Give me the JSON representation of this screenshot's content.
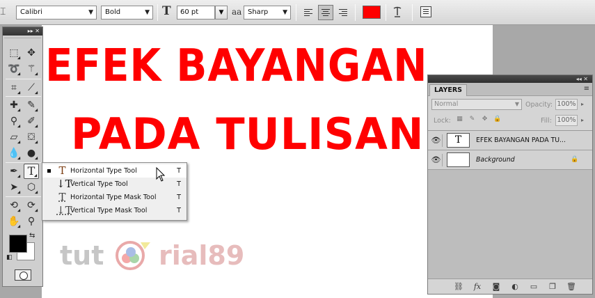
{
  "options_bar": {
    "tool_preset_icon": "type-tool-preset-icon",
    "font_family": "Calibri",
    "font_style": "Bold",
    "font_size": "60 pt",
    "antialias_glyph": "aa",
    "antialias": "Sharp",
    "alignment": [
      "left",
      "center",
      "right"
    ],
    "alignment_selected": "center",
    "text_color": "#ff0000",
    "warp_icon": "warp-text-icon",
    "panels_icon": "character-paragraph-panels-icon"
  },
  "canvas": {
    "line1": "EFEK BAYANGAN",
    "line2": "PADA TULISAN",
    "text_color": "#ff0000",
    "watermark": {
      "part1": "tut",
      "part2": "rial89"
    }
  },
  "toolbox": {
    "collapse_glyph": "▸▸",
    "close_glyph": "✕",
    "tools": [
      "rectangular-marquee-icon",
      "move-tool-icon",
      "lasso-icon",
      "magic-wand-icon",
      "crop-icon",
      "eyedropper-icon",
      "spot-healing-brush-icon",
      "brush-icon",
      "clone-stamp-icon",
      "history-brush-icon",
      "eraser-icon",
      "paint-bucket-icon",
      "blur-icon",
      "dodge-icon",
      "pen-icon",
      "horizontal-type-icon",
      "path-selection-icon",
      "custom-shape-icon",
      "3d-rotate-icon",
      "3d-orbit-icon",
      "hand-icon",
      "zoom-icon"
    ],
    "selected_tool": "horizontal-type-icon",
    "foreground_color": "#000000",
    "background_color": "#ffffff"
  },
  "flyout": {
    "items": [
      {
        "label": "Horizontal Type Tool",
        "key": "T",
        "icon": "horizontal-type-icon",
        "active": true
      },
      {
        "label": "Vertical Type Tool",
        "key": "T",
        "icon": "vertical-type-icon",
        "active": false
      },
      {
        "label": "Horizontal Type Mask Tool",
        "key": "T",
        "icon": "horizontal-type-mask-icon",
        "active": false
      },
      {
        "label": "Vertical Type Mask Tool",
        "key": "T",
        "icon": "vertical-type-mask-icon",
        "active": false
      }
    ]
  },
  "layers_panel": {
    "header_glyphs": "◂◂ ✕",
    "tab": "LAYERS",
    "menu_glyph": "≡",
    "blend_mode": "Normal",
    "opacity_label": "Opacity:",
    "opacity": "100%",
    "lock_label": "Lock:",
    "fill_label": "Fill:",
    "fill": "100%",
    "layers": [
      {
        "name": "EFEK BAYANGAN PADA TU...",
        "thumb": "T",
        "visible": true,
        "italic": false,
        "locked": false
      },
      {
        "name": "Background",
        "thumb": "",
        "visible": true,
        "italic": true,
        "locked": true
      }
    ],
    "footer_icons": [
      "link-layers-icon",
      "layer-style-icon",
      "layer-mask-icon",
      "adjustment-layer-icon",
      "new-group-icon",
      "new-layer-icon",
      "delete-layer-icon"
    ]
  }
}
